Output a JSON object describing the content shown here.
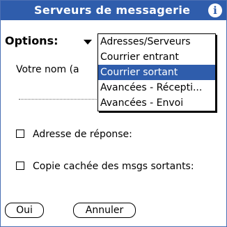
{
  "title": "Serveurs de messagerie",
  "info_icon": "i",
  "options_label": "Options:",
  "field_label": "Votre nom (a",
  "checkboxes": [
    {
      "label": "Adresse de réponse:",
      "checked": false
    },
    {
      "label": "Copie cachée des msgs sortants:",
      "checked": false
    }
  ],
  "buttons": {
    "ok": "Oui",
    "cancel": "Annuler"
  },
  "dropdown": {
    "items": [
      "Adresses/Serveurs",
      "Courrier entrant",
      "Courrier sortant",
      "Avancées - Récepti...",
      "Avancées - Envoi"
    ],
    "selected_index": 2
  },
  "colors": {
    "accent": "#2f5dac"
  }
}
